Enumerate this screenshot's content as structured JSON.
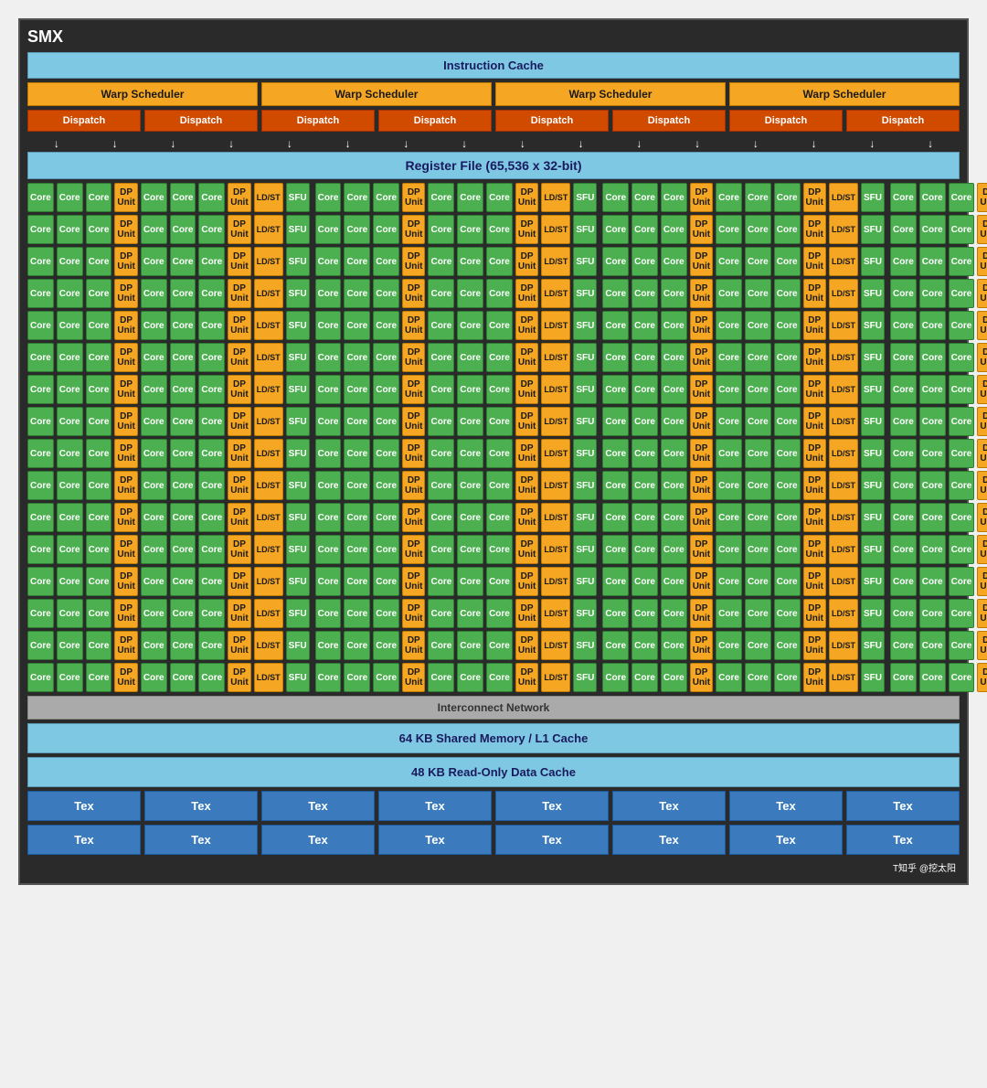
{
  "title": "SMX",
  "instruction_cache": "Instruction Cache",
  "warp_schedulers": [
    "Warp Scheduler",
    "Warp Scheduler",
    "Warp Scheduler",
    "Warp Scheduler"
  ],
  "dispatch_units": [
    "Dispatch",
    "Dispatch",
    "Dispatch",
    "Dispatch",
    "Dispatch",
    "Dispatch",
    "Dispatch",
    "Dispatch"
  ],
  "register_file": "Register File (65,536 x 32-bit)",
  "interconnect": "Interconnect Network",
  "shared_memory": "64 KB Shared Memory / L1 Cache",
  "readonly_cache": "48 KB Read-Only Data Cache",
  "tex_rows": [
    [
      "Tex",
      "Tex",
      "Tex",
      "Tex",
      "Tex",
      "Tex",
      "Tex",
      "Tex"
    ],
    [
      "Tex",
      "Tex",
      "Tex",
      "Tex",
      "Tex",
      "Tex",
      "Tex",
      "Tex"
    ]
  ],
  "watermark": "T知乎 @挖太阳",
  "core_label": "Core",
  "dp_label": "DP Unit",
  "ldst_label": "LD/ST",
  "sfu_label": "SFU",
  "num_rows": 16,
  "colors": {
    "core_bg": "#4caf50",
    "dp_bg": "#f5a623",
    "sfu_bg": "#4caf50",
    "ldst_bg": "#f5a623",
    "warp_bg": "#f5a623",
    "dispatch_bg": "#d04a00",
    "cache_bg": "#7ec8e3",
    "tex_bg": "#3a7abd",
    "interconnect_bg": "#aaaaaa"
  }
}
